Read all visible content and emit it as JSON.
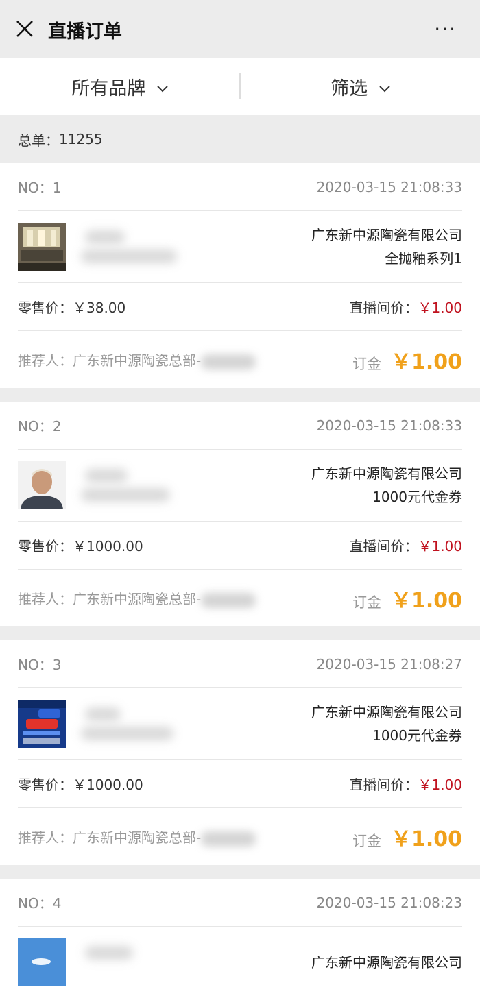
{
  "header": {
    "title": "直播订单",
    "close_icon": "close-icon",
    "more_icon": "more-icon",
    "more_label": "···"
  },
  "filters": {
    "brand": "所有品牌",
    "filter": "筛选"
  },
  "summary": {
    "total_label": "总单：",
    "total_value": "11255"
  },
  "labels": {
    "retail": "零售价：",
    "live": "直播间价：",
    "referrer": "推荐人：",
    "deposit": "订金"
  },
  "orders": [
    {
      "no": "NO：1",
      "time": "2020-03-15 21:08:33",
      "company": "广东新中源陶瓷有限公司",
      "product": "全抛釉系列1",
      "retail": "￥38.00",
      "live": "￥1.00",
      "referrer": "广东新中源陶瓷总部-",
      "deposit": "￥1.00",
      "thumb": "room"
    },
    {
      "no": "NO：2",
      "time": "2020-03-15 21:08:33",
      "company": "广东新中源陶瓷有限公司",
      "product": "1000元代金券",
      "retail": "￥1000.00",
      "live": "￥1.00",
      "referrer": "广东新中源陶瓷总部-",
      "deposit": "￥1.00",
      "thumb": "portrait"
    },
    {
      "no": "NO：3",
      "time": "2020-03-15 21:08:27",
      "company": "广东新中源陶瓷有限公司",
      "product": "1000元代金券",
      "retail": "￥1000.00",
      "live": "￥1.00",
      "referrer": "广东新中源陶瓷总部-",
      "deposit": "￥1.00",
      "thumb": "poster"
    },
    {
      "no": "NO：4",
      "time": "2020-03-15 21:08:23",
      "company": "广东新中源陶瓷有限公司",
      "thumb": "sky"
    }
  ],
  "colors": {
    "accent_orange": "#f0a11b",
    "price_red": "#c0121f",
    "bg_gray": "#ececec"
  }
}
